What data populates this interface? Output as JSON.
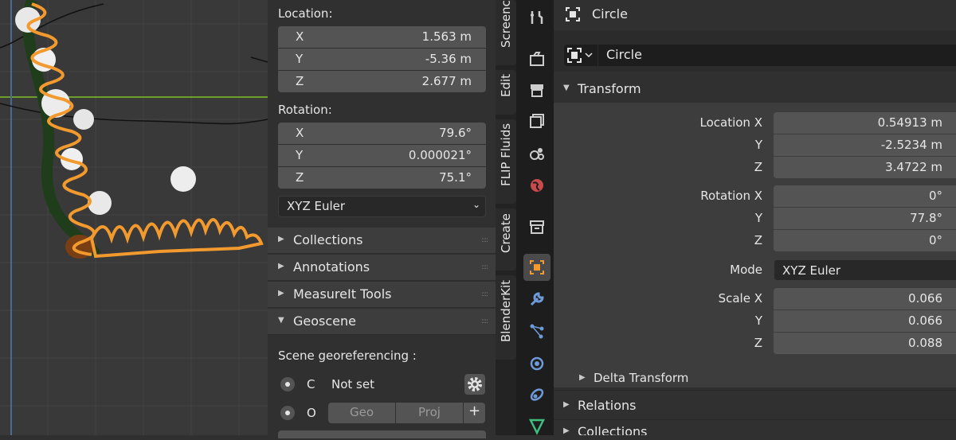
{
  "npanel": {
    "location_label": "Location:",
    "location": [
      {
        "axis": "X",
        "value": "1.563 m"
      },
      {
        "axis": "Y",
        "value": "-5.36 m"
      },
      {
        "axis": "Z",
        "value": "2.677 m"
      }
    ],
    "rotation_label": "Rotation:",
    "rotation": [
      {
        "axis": "X",
        "value": "79.6°"
      },
      {
        "axis": "Y",
        "value": "0.000021°"
      },
      {
        "axis": "Z",
        "value": "75.1°"
      }
    ],
    "rotation_mode": "XYZ Euler",
    "panels": [
      "Collections",
      "Annotations",
      "MeasureIt Tools",
      "Geoscene"
    ],
    "geoscene": {
      "heading": "Scene georeferencing :",
      "row_c_letter": "C",
      "row_c_value": "Not set",
      "row_o_letter": "O",
      "geo_button": "Geo",
      "proj_button": "Proj",
      "plus_button": "+"
    }
  },
  "vtabs": [
    "Screenca",
    "Edit",
    "FLIP Fluids",
    "Create",
    "BlenderKit"
  ],
  "props": {
    "header_object": "Circle",
    "datablock_name": "Circle",
    "transform_title": "Transform",
    "location_x_label": "Location X",
    "location": [
      "0.54913 m",
      "-2.5234 m",
      "3.4722 m"
    ],
    "rotation_x_label": "Rotation X",
    "rotation": [
      "0°",
      "77.8°",
      "0°"
    ],
    "mode_label": "Mode",
    "mode_value": "XYZ Euler",
    "scale_x_label": "Scale X",
    "scale": [
      "0.066",
      "0.066",
      "0.088"
    ],
    "y_label": "Y",
    "z_label": "Z",
    "delta_transform": "Delta Transform",
    "relations": "Relations",
    "collections": "Collections"
  },
  "colors": {
    "selection_outline": "#f29a2e",
    "active_tab": "#4a4a4a",
    "field_bg": "#545454",
    "panel_bg": "#303030"
  }
}
